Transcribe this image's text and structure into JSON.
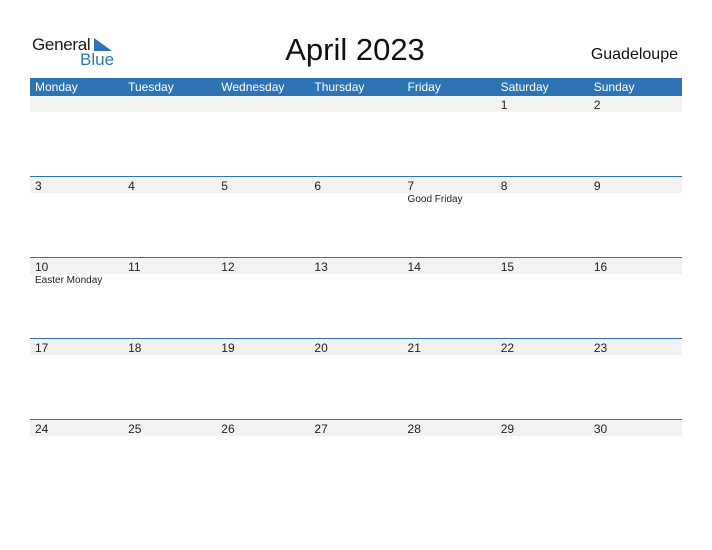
{
  "logo": {
    "part1": "General",
    "part2": "Blue"
  },
  "title": "April 2023",
  "country": "Guadeloupe",
  "colors": {
    "accent": "#2e74b5",
    "strip": "#f2f2f2"
  },
  "weekdays": [
    "Monday",
    "Tuesday",
    "Wednesday",
    "Thursday",
    "Friday",
    "Saturday",
    "Sunday"
  ],
  "weeks": [
    {
      "days": [
        {
          "num": "",
          "event": ""
        },
        {
          "num": "",
          "event": ""
        },
        {
          "num": "",
          "event": ""
        },
        {
          "num": "",
          "event": ""
        },
        {
          "num": "",
          "event": ""
        },
        {
          "num": "1",
          "event": ""
        },
        {
          "num": "2",
          "event": ""
        }
      ]
    },
    {
      "days": [
        {
          "num": "3",
          "event": ""
        },
        {
          "num": "4",
          "event": ""
        },
        {
          "num": "5",
          "event": ""
        },
        {
          "num": "6",
          "event": ""
        },
        {
          "num": "7",
          "event": "Good Friday"
        },
        {
          "num": "8",
          "event": ""
        },
        {
          "num": "9",
          "event": ""
        }
      ]
    },
    {
      "days": [
        {
          "num": "10",
          "event": "Easter Monday"
        },
        {
          "num": "11",
          "event": ""
        },
        {
          "num": "12",
          "event": ""
        },
        {
          "num": "13",
          "event": ""
        },
        {
          "num": "14",
          "event": ""
        },
        {
          "num": "15",
          "event": ""
        },
        {
          "num": "16",
          "event": ""
        }
      ]
    },
    {
      "days": [
        {
          "num": "17",
          "event": ""
        },
        {
          "num": "18",
          "event": ""
        },
        {
          "num": "19",
          "event": ""
        },
        {
          "num": "20",
          "event": ""
        },
        {
          "num": "21",
          "event": ""
        },
        {
          "num": "22",
          "event": ""
        },
        {
          "num": "23",
          "event": ""
        }
      ]
    },
    {
      "days": [
        {
          "num": "24",
          "event": ""
        },
        {
          "num": "25",
          "event": ""
        },
        {
          "num": "26",
          "event": ""
        },
        {
          "num": "27",
          "event": ""
        },
        {
          "num": "28",
          "event": ""
        },
        {
          "num": "29",
          "event": ""
        },
        {
          "num": "30",
          "event": ""
        }
      ]
    }
  ]
}
